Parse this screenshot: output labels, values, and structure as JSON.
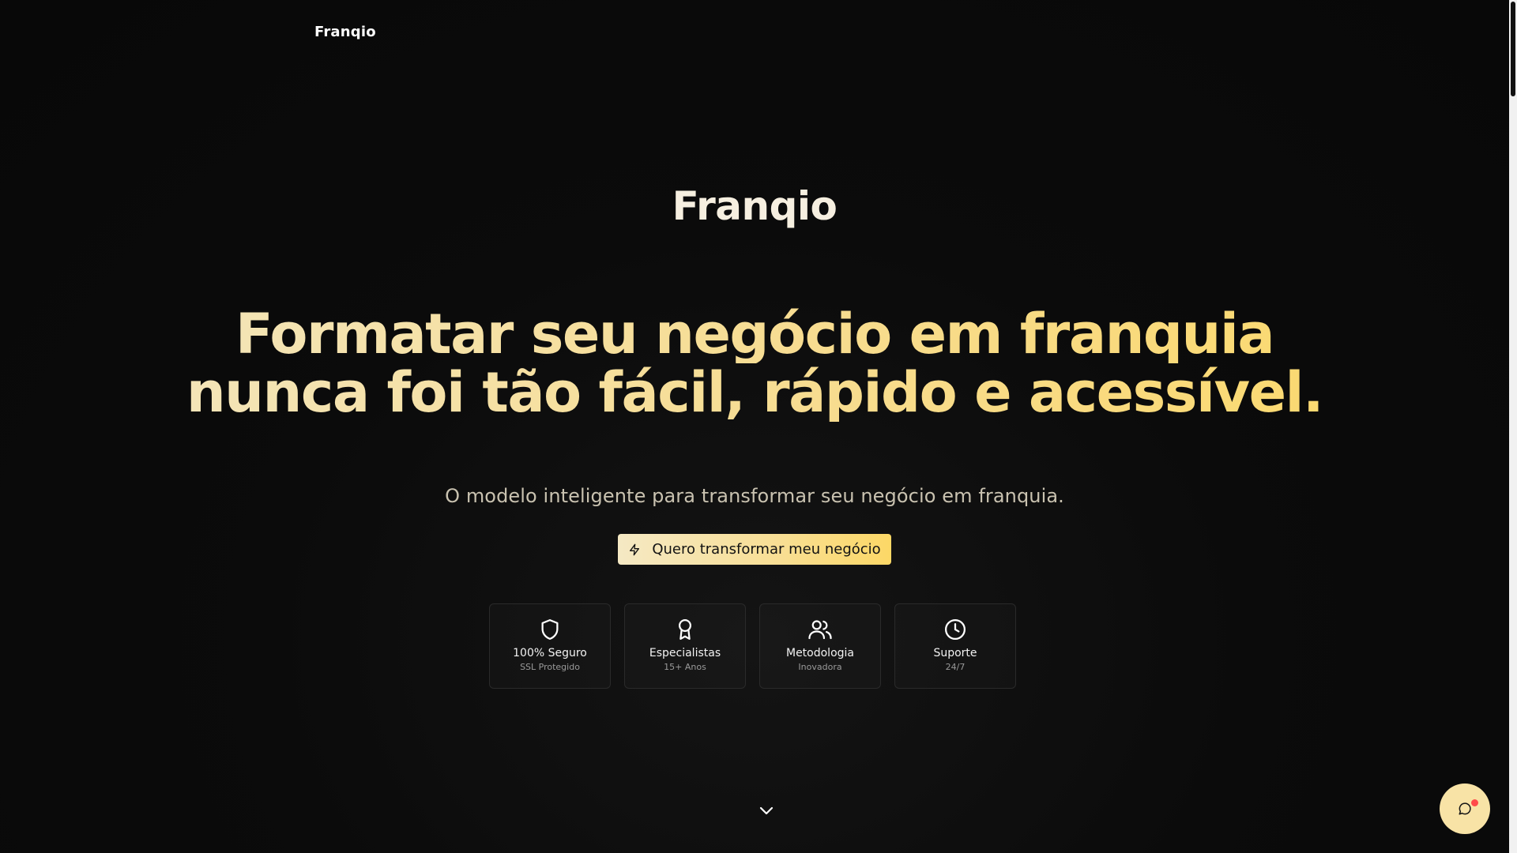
{
  "header": {
    "logo": "Franqio"
  },
  "hero": {
    "brand": "Franqio",
    "headline_line1": "Formatar seu negócio em franquia",
    "headline_line2": "nunca foi tão fácil, rápido e acessível.",
    "subtitle": "O modelo inteligente para transformar seu negócio em franquia.",
    "cta_label": "Quero transformar meu negócio",
    "cta_icon": "lightning-icon"
  },
  "features": [
    {
      "icon": "shield-icon",
      "title": "100% Seguro",
      "subtitle": "SSL Protegido"
    },
    {
      "icon": "award-icon",
      "title": "Especialistas",
      "subtitle": "15+ Anos"
    },
    {
      "icon": "users-icon",
      "title": "Metodologia",
      "subtitle": "Inovadora"
    },
    {
      "icon": "clock-icon",
      "title": "Suporte",
      "subtitle": "24/7"
    }
  ],
  "colors": {
    "accent_light": "#f5e9c4",
    "accent": "#fcd866",
    "background": "#080808",
    "notification_dot": "#ff4a4a"
  },
  "widgets": {
    "scroll_icon": "chevron-down-icon",
    "chat_icon": "chat-bubble-icon"
  }
}
